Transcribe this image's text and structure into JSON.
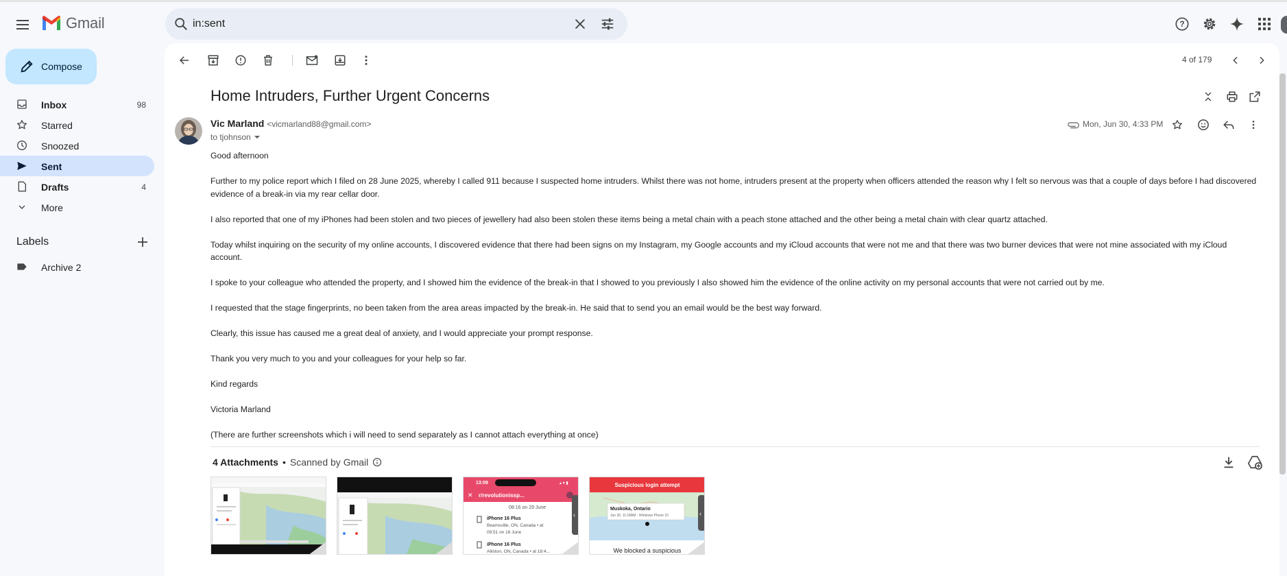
{
  "app": {
    "name": "Gmail",
    "brand_color": "#ea4335"
  },
  "search": {
    "query": "in:sent"
  },
  "sidebar": {
    "compose_label": "Compose",
    "items": [
      {
        "label": "Inbox",
        "count": "98",
        "icon": "inbox-icon"
      },
      {
        "label": "Starred",
        "count": "",
        "icon": "star-icon"
      },
      {
        "label": "Snoozed",
        "count": "",
        "icon": "clock-icon"
      },
      {
        "label": "Sent",
        "count": "",
        "icon": "send-icon",
        "active": true
      },
      {
        "label": "Drafts",
        "count": "4",
        "icon": "draft-icon"
      },
      {
        "label": "More",
        "count": "",
        "icon": "chevron-down-icon"
      }
    ],
    "labels_title": "Labels",
    "labels": [
      {
        "label": "Archive 2",
        "icon": "label-icon"
      }
    ]
  },
  "toolbar": {
    "pager": "4 of 179"
  },
  "email": {
    "subject": "Home Intruders, Further Urgent Concerns",
    "sender_name": "Vic Marland",
    "sender_email": "<vicmarland88@gmail.com>",
    "to": "to tjohnson",
    "date": "Mon, Jun 30, 4:33 PM",
    "paragraphs": [
      "Good afternoon",
      "Further to my police report which I filed on 28 June 2025, whereby I called 911 because I suspected home intruders.  Whilst there was not home, intruders present at the property when officers attended the reason why I felt so nervous was that a couple of days before I had discovered evidence of a break-in via my rear cellar door.",
      "I also reported that one of my iPhones had been stolen and two pieces of jewellery had also been stolen these items being a metal chain with a peach stone attached and the other being a metal chain with clear quartz attached.",
      "Today whilst inquiring on the security of my online accounts, I discovered evidence that there had been signs on my Instagram, my Google accounts and my iCloud accounts that were not me and that there was two burner devices that were not mine associated with my iCloud account.",
      "I spoke to your colleague who attended the property, and I showed him the evidence of the break-in that I showed to you previously I also showed him the evidence of the online activity on my personal accounts that were not carried out by me.",
      "I requested that the stage fingerprints, no been taken from the area areas impacted by the break-in.  He said that to send you an email would be the best way forward.",
      "Clearly, this issue has caused me a great deal of anxiety, and I would appreciate your prompt response.",
      "Thank you very much to you and your colleagues for your help so far.",
      "Kind regards",
      "Victoria Marland",
      "(There are further screenshots which i will need to send separately as I cannot attach everything at once)"
    ]
  },
  "attachments": {
    "count_label": "4 Attachments",
    "scanned_label": "Scanned by Gmail",
    "thumb3": {
      "time": "13:09",
      "title": "r/revolutionissp...",
      "line1": "08:16 on 29 June",
      "dev1": "iPhone 16 Plus",
      "loc1": "Beamsville, ON, Canada • at",
      "time1": "09:51 on 18 June",
      "dev2": "iPhone 16 Plus",
      "loc2": "Alliston, ON, Canada • at 18:4..."
    },
    "thumb4": {
      "banner": "Suspicious login attempt",
      "place": "Muskoka, Ontario",
      "detail": "Jun 30, 11:18AM - Windows Phone 10",
      "footer": "We blocked a suspicious"
    }
  }
}
